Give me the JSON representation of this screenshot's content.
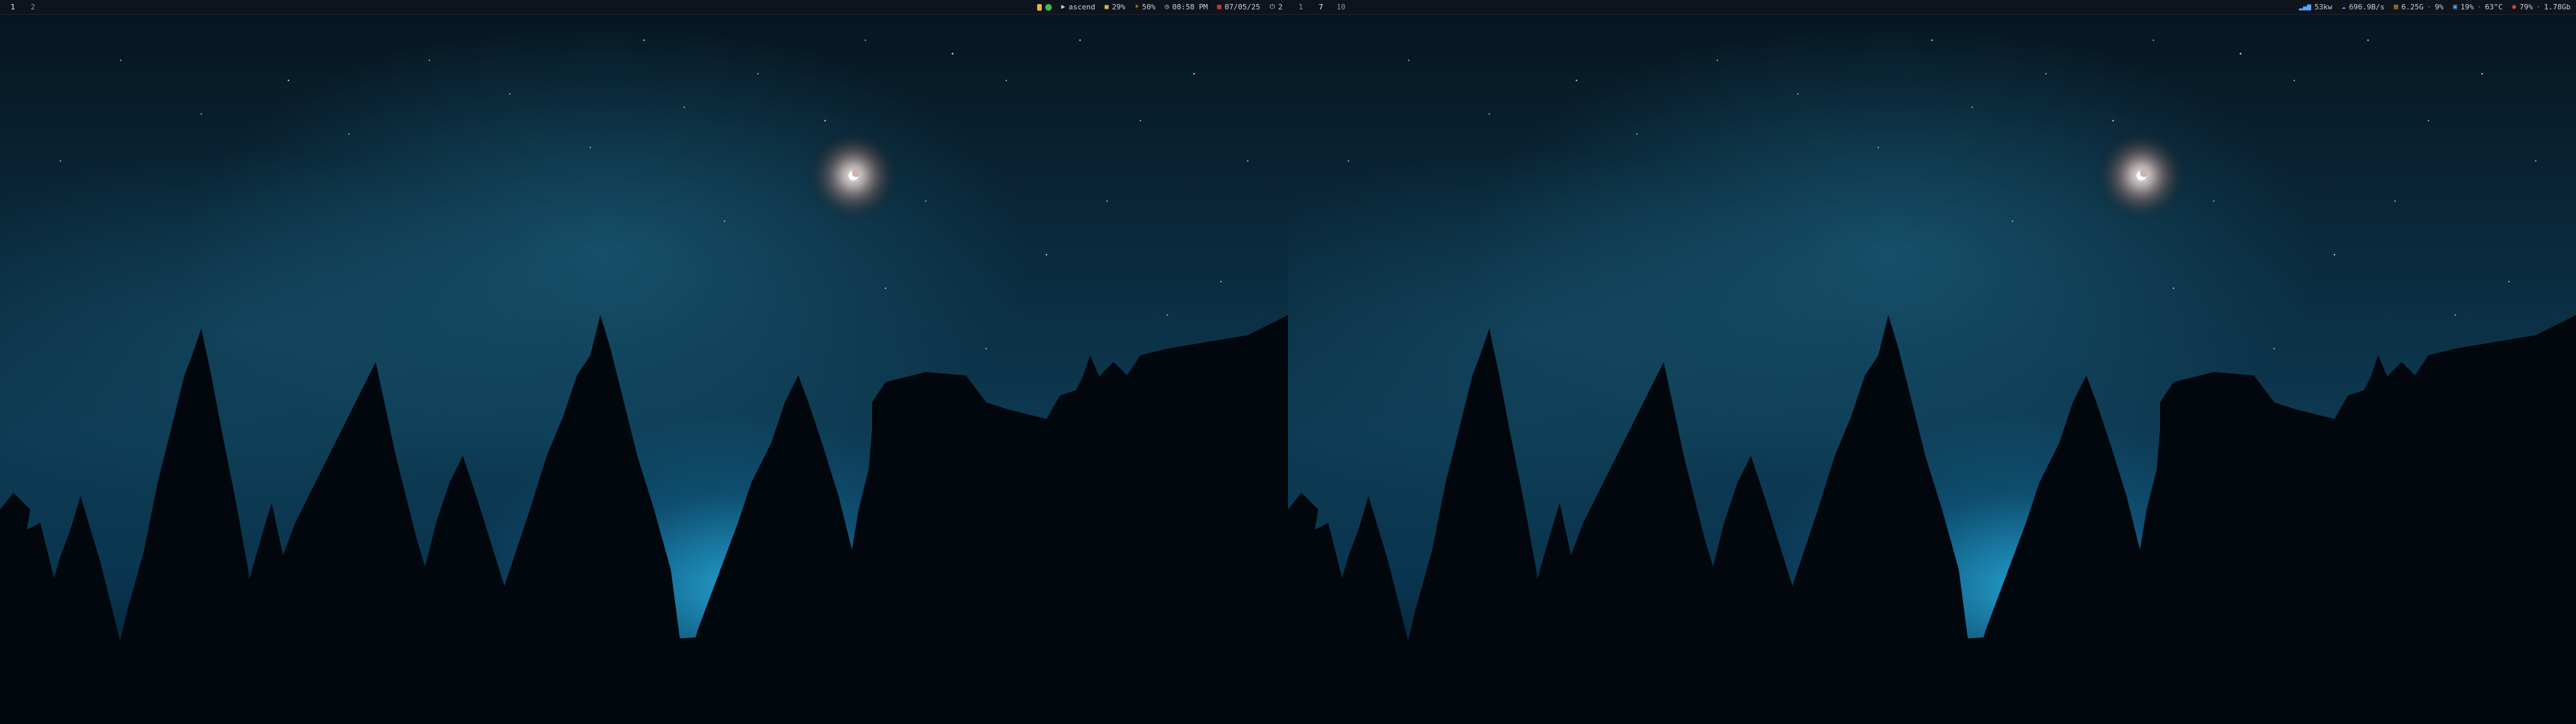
{
  "left_monitor": {
    "workspaces": [
      "1",
      "2"
    ],
    "active_workspace": "1",
    "tray": {
      "lock_icon": "battery-icon",
      "spotify_icon": "spotify-icon",
      "player_icon": "play-icon",
      "player_label": "ascend",
      "volume_icon": "speaker-icon",
      "volume_value": "29%",
      "brightness_icon": "sun-icon",
      "brightness_value": "50%",
      "clock_icon": "clock-icon",
      "time": "08:58 PM",
      "calendar_icon": "calendar-icon",
      "date": "07/05/25",
      "power_icon": "power-icon",
      "power_label": "2"
    }
  },
  "right_monitor": {
    "workspaces": [
      "1",
      "7",
      "10"
    ],
    "active_workspace": "7",
    "stats": {
      "wifi_icon": "signal-icon",
      "wifi_value": "53kw",
      "network_icon": "cloud-download-icon",
      "network_value": "696.9B/s",
      "ram_icon": "ram-icon",
      "ram_value": "6.25G",
      "ram_pct": "9%",
      "cpu_icon": "cpu-icon",
      "cpu_value": "19%",
      "temp_value": "63°C",
      "disk_icon": "disk-icon",
      "disk_pct": "79%",
      "disk_value": "1.78Gb"
    }
  },
  "colors": {
    "bar_bg": "#0f141c",
    "text": "#c9d1d9",
    "accent_green": "#3fb950",
    "accent_yellow": "#e3b341",
    "accent_blue": "#58a6ff",
    "accent_red": "#f85149"
  }
}
